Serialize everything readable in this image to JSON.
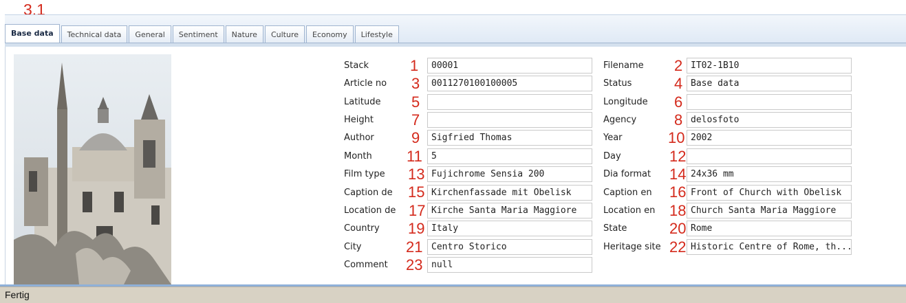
{
  "section_label": "3.1",
  "tabs": [
    {
      "label": "Base data",
      "active": true
    },
    {
      "label": "Technical data",
      "active": false
    },
    {
      "label": "General",
      "active": false
    },
    {
      "label": "Sentiment",
      "active": false
    },
    {
      "label": "Nature",
      "active": false
    },
    {
      "label": "Culture",
      "active": false
    },
    {
      "label": "Economy",
      "active": false
    },
    {
      "label": "Lifestyle",
      "active": false
    }
  ],
  "left_fields": [
    {
      "label": "Stack",
      "num": "1",
      "value": "00001"
    },
    {
      "label": "Article no",
      "num": "3",
      "value": "0011270100100005"
    },
    {
      "label": "Latitude",
      "num": "5",
      "value": ""
    },
    {
      "label": "Height",
      "num": "7",
      "value": ""
    },
    {
      "label": "Author",
      "num": "9",
      "value": "Sigfried Thomas"
    },
    {
      "label": "Month",
      "num": "11",
      "value": "5"
    },
    {
      "label": "Film type",
      "num": "13",
      "value": "Fujichrome Sensia 200"
    },
    {
      "label": "Caption de",
      "num": "15",
      "value": "Kirchenfassade mit Obelisk"
    },
    {
      "label": "Location de",
      "num": "17",
      "value": "Kirche Santa Maria Maggiore"
    },
    {
      "label": "Country",
      "num": "19",
      "value": "Italy"
    },
    {
      "label": "City",
      "num": "21",
      "value": "Centro Storico"
    },
    {
      "label": "Comment",
      "num": "23",
      "value": "null"
    }
  ],
  "right_fields": [
    {
      "label": "Filename",
      "num": "2",
      "value": "IT02-1B10"
    },
    {
      "label": "Status",
      "num": "4",
      "value": "Base data"
    },
    {
      "label": "Longitude",
      "num": "6",
      "value": ""
    },
    {
      "label": "Agency",
      "num": "8",
      "value": "delosfoto"
    },
    {
      "label": "Year",
      "num": "10",
      "value": "2002"
    },
    {
      "label": "Day",
      "num": "12",
      "value": ""
    },
    {
      "label": "Dia format",
      "num": "14",
      "value": "24x36 mm"
    },
    {
      "label": "Caption en",
      "num": "16",
      "value": "Front of Church with Obelisk"
    },
    {
      "label": "Location en",
      "num": "18",
      "value": "Church Santa Maria Maggiore"
    },
    {
      "label": "State",
      "num": "20",
      "value": "Rome"
    },
    {
      "label": "Heritage site",
      "num": "22",
      "value": "Historic Centre of Rome, th..."
    }
  ],
  "status_text": "Fertig",
  "colors": {
    "annotation": "#d42a1c",
    "accent": "#8fb0d8"
  }
}
